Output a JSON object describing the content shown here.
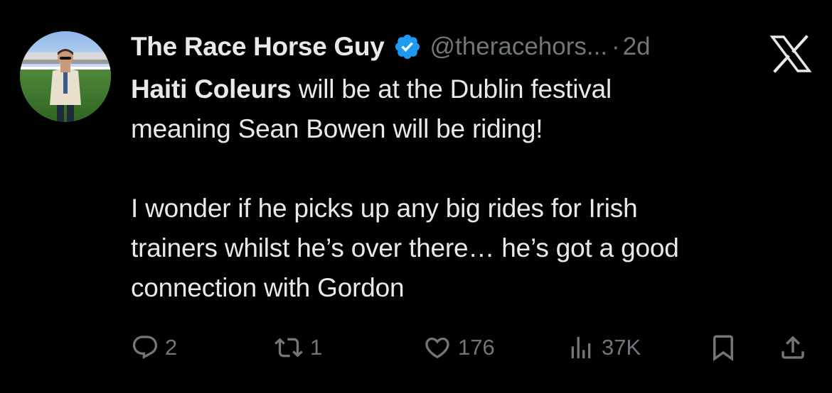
{
  "tweet": {
    "author": {
      "display_name": "The Race Horse Guy",
      "handle": "@theracehors...",
      "verified": true
    },
    "separator": "·",
    "time": "2d",
    "text": {
      "bold_prefix": "Haiti Coleurs",
      "line1_rest": " will be at the Dublin festival",
      "line2": "meaning Sean Bowen will be riding!",
      "paragraph2_line1": "I wonder if he picks up any big rides for Irish",
      "paragraph2_line2": "trainers whilst he’s over there… he’s got a good",
      "paragraph2_line3": "connection with Gordon"
    },
    "metrics": {
      "replies": "2",
      "retweets": "1",
      "likes": "176",
      "views": "37K"
    }
  },
  "icons": {
    "verified": "verified-badge-icon",
    "brand": "x-logo-icon",
    "reply": "reply-icon",
    "retweet": "retweet-icon",
    "like": "heart-icon",
    "views": "views-icon",
    "bookmark": "bookmark-icon",
    "share": "share-icon"
  },
  "colors": {
    "background": "#000000",
    "text_primary": "#e7e9ea",
    "text_secondary": "#71767b",
    "verified_blue": "#1d9bf0"
  }
}
